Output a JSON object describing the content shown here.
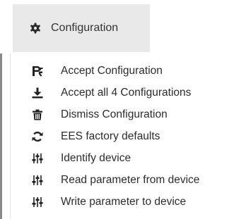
{
  "header": {
    "tab_label": "Configuration",
    "tab_icon": "gear-icon"
  },
  "menu": {
    "items": [
      {
        "label": "Accept Configuration",
        "icon": "accept-configuration-icon"
      },
      {
        "label": "Accept all 4 Configurations",
        "icon": "download-icon"
      },
      {
        "label": "Dismiss Configuration",
        "icon": "trash-icon"
      },
      {
        "label": "EES factory defaults",
        "icon": "refresh-icon"
      },
      {
        "label": "Identify device",
        "icon": "sliders-icon"
      },
      {
        "label": "Read parameter from device",
        "icon": "sliders-icon"
      },
      {
        "label": "Write parameter to device",
        "icon": "sliders-icon"
      }
    ]
  },
  "colors": {
    "tab_background": "#e9e9e9",
    "icon": "#222222",
    "text": "#2c2c2c"
  }
}
